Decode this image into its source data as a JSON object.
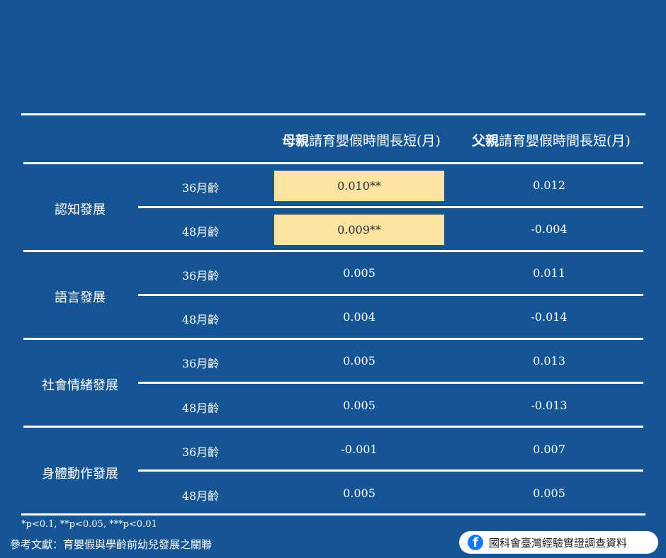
{
  "table": {
    "header": {
      "mother_bold": "母親",
      "mother_rest": "請育嬰假時間長短(月)",
      "father_bold": "父親",
      "father_rest": "請育嬰假時間長短(月)"
    },
    "groups": [
      {
        "category": "認知發展",
        "rows": [
          {
            "age": "36月齡",
            "mother": "0.010**",
            "father": "0.012",
            "highlight": true
          },
          {
            "age": "48月齡",
            "mother": "0.009**",
            "father": "-0.004",
            "highlight": true
          }
        ]
      },
      {
        "category": "語言發展",
        "rows": [
          {
            "age": "36月齡",
            "mother": "0.005",
            "father": "0.011"
          },
          {
            "age": "48月齡",
            "mother": "0.004",
            "father": "-0.014"
          }
        ]
      },
      {
        "category": "社會情緒發展",
        "rows": [
          {
            "age": "36月齡",
            "mother": "0.005",
            "father": "0.013"
          },
          {
            "age": "48月齡",
            "mother": "0.005",
            "father": "-0.013"
          }
        ]
      },
      {
        "category": "身體動作發展",
        "rows": [
          {
            "age": "36月齡",
            "mother": "-0.001",
            "father": "0.007"
          },
          {
            "age": "48月齡",
            "mother": "0.005",
            "father": "0.005"
          }
        ]
      }
    ]
  },
  "footnote": "*p<0.1, **p<0.05, ***p<0.01",
  "reference": "參考文獻：育嬰假與學齡前幼兒發展之關聯",
  "badge": {
    "icon": "facebook-icon",
    "label": "國科會臺灣經驗實證調查資料"
  },
  "colors": {
    "background": "#155593",
    "highlight": "#fde3a0",
    "text": "#ffffff"
  }
}
